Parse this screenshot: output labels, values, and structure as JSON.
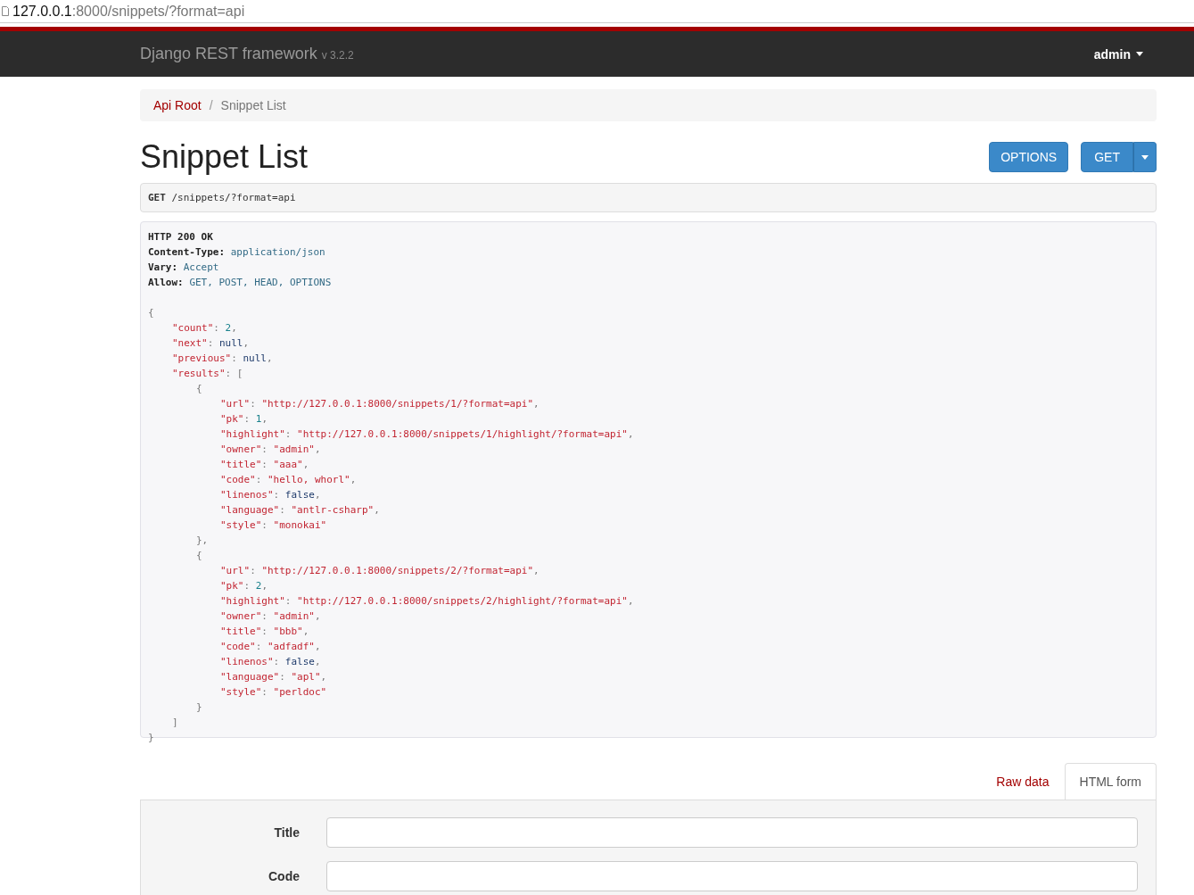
{
  "address_bar": {
    "host": "127.0.0.1",
    "rest": ":8000/snippets/?format=api"
  },
  "navbar": {
    "brand": "Django REST framework",
    "version": "v 3.2.2",
    "user": "admin"
  },
  "breadcrumb": [
    {
      "label": "Api Root",
      "selected": false
    },
    {
      "label": "Snippet List",
      "selected": true
    }
  ],
  "breadcrumb_separator": "/",
  "page_title": "Snippet List",
  "buttons": [
    {
      "label": "OPTIONS",
      "kind": "plain"
    },
    {
      "label": "GET",
      "kind": "split"
    }
  ],
  "request": {
    "method": "GET",
    "path": "/snippets/?format=api"
  },
  "response_headers": [
    {
      "name": "HTTP 200 OK"
    },
    {
      "name": "Content-Type:",
      "value": "application/json"
    },
    {
      "name": "Vary:",
      "value": "Accept"
    },
    {
      "name": "Allow:",
      "value": "GET, POST, HEAD, OPTIONS"
    }
  ],
  "response_body": [
    {
      "tokens": [
        {
          "kind": "punct",
          "text": "{"
        }
      ],
      "children": [
        {
          "tokens": [
            {
              "kind": "key",
              "text": "\"count\""
            },
            {
              "kind": "punct",
              "text": ": "
            },
            {
              "kind": "number",
              "text": "2"
            },
            {
              "kind": "punct",
              "text": ","
            }
          ]
        },
        {
          "tokens": [
            {
              "kind": "key",
              "text": "\"next\""
            },
            {
              "kind": "punct",
              "text": ": "
            },
            {
              "kind": "literal",
              "text": "null"
            },
            {
              "kind": "punct",
              "text": ","
            }
          ]
        },
        {
          "tokens": [
            {
              "kind": "key",
              "text": "\"previous\""
            },
            {
              "kind": "punct",
              "text": ": "
            },
            {
              "kind": "literal",
              "text": "null"
            },
            {
              "kind": "punct",
              "text": ","
            }
          ]
        },
        {
          "tokens": [
            {
              "kind": "key",
              "text": "\"results\""
            },
            {
              "kind": "punct",
              "text": ": ["
            }
          ],
          "children": [
            {
              "tokens": [
                {
                  "kind": "punct",
                  "text": "{"
                }
              ],
              "children": [
                {
                  "tokens": [
                    {
                      "kind": "key",
                      "text": "\"url\""
                    },
                    {
                      "kind": "punct",
                      "text": ": "
                    },
                    {
                      "kind": "string",
                      "text": "\"http://127.0.0.1:8000/snippets/1/?format=api\""
                    },
                    {
                      "kind": "punct",
                      "text": ","
                    }
                  ]
                },
                {
                  "tokens": [
                    {
                      "kind": "key",
                      "text": "\"pk\""
                    },
                    {
                      "kind": "punct",
                      "text": ": "
                    },
                    {
                      "kind": "number",
                      "text": "1"
                    },
                    {
                      "kind": "punct",
                      "text": ","
                    }
                  ]
                },
                {
                  "tokens": [
                    {
                      "kind": "key",
                      "text": "\"highlight\""
                    },
                    {
                      "kind": "punct",
                      "text": ": "
                    },
                    {
                      "kind": "string",
                      "text": "\"http://127.0.0.1:8000/snippets/1/highlight/?format=api\""
                    },
                    {
                      "kind": "punct",
                      "text": ","
                    }
                  ]
                },
                {
                  "tokens": [
                    {
                      "kind": "key",
                      "text": "\"owner\""
                    },
                    {
                      "kind": "punct",
                      "text": ": "
                    },
                    {
                      "kind": "string",
                      "text": "\"admin\""
                    },
                    {
                      "kind": "punct",
                      "text": ","
                    }
                  ]
                },
                {
                  "tokens": [
                    {
                      "kind": "key",
                      "text": "\"title\""
                    },
                    {
                      "kind": "punct",
                      "text": ": "
                    },
                    {
                      "kind": "string",
                      "text": "\"aaa\""
                    },
                    {
                      "kind": "punct",
                      "text": ","
                    }
                  ]
                },
                {
                  "tokens": [
                    {
                      "kind": "key",
                      "text": "\"code\""
                    },
                    {
                      "kind": "punct",
                      "text": ": "
                    },
                    {
                      "kind": "string",
                      "text": "\"hello, whorl\""
                    },
                    {
                      "kind": "punct",
                      "text": ","
                    }
                  ]
                },
                {
                  "tokens": [
                    {
                      "kind": "key",
                      "text": "\"linenos\""
                    },
                    {
                      "kind": "punct",
                      "text": ": "
                    },
                    {
                      "kind": "literal",
                      "text": "false"
                    },
                    {
                      "kind": "punct",
                      "text": ","
                    }
                  ]
                },
                {
                  "tokens": [
                    {
                      "kind": "key",
                      "text": "\"language\""
                    },
                    {
                      "kind": "punct",
                      "text": ": "
                    },
                    {
                      "kind": "string",
                      "text": "\"antlr-csharp\""
                    },
                    {
                      "kind": "punct",
                      "text": ","
                    }
                  ]
                },
                {
                  "tokens": [
                    {
                      "kind": "key",
                      "text": "\"style\""
                    },
                    {
                      "kind": "punct",
                      "text": ": "
                    },
                    {
                      "kind": "string",
                      "text": "\"monokai\""
                    }
                  ]
                }
              ]
            },
            {
              "tokens": [
                {
                  "kind": "punct",
                  "text": "},"
                }
              ]
            },
            {
              "tokens": [
                {
                  "kind": "punct",
                  "text": "{"
                }
              ],
              "children": [
                {
                  "tokens": [
                    {
                      "kind": "key",
                      "text": "\"url\""
                    },
                    {
                      "kind": "punct",
                      "text": ": "
                    },
                    {
                      "kind": "string",
                      "text": "\"http://127.0.0.1:8000/snippets/2/?format=api\""
                    },
                    {
                      "kind": "punct",
                      "text": ","
                    }
                  ]
                },
                {
                  "tokens": [
                    {
                      "kind": "key",
                      "text": "\"pk\""
                    },
                    {
                      "kind": "punct",
                      "text": ": "
                    },
                    {
                      "kind": "number",
                      "text": "2"
                    },
                    {
                      "kind": "punct",
                      "text": ","
                    }
                  ]
                },
                {
                  "tokens": [
                    {
                      "kind": "key",
                      "text": "\"highlight\""
                    },
                    {
                      "kind": "punct",
                      "text": ": "
                    },
                    {
                      "kind": "string",
                      "text": "\"http://127.0.0.1:8000/snippets/2/highlight/?format=api\""
                    },
                    {
                      "kind": "punct",
                      "text": ","
                    }
                  ]
                },
                {
                  "tokens": [
                    {
                      "kind": "key",
                      "text": "\"owner\""
                    },
                    {
                      "kind": "punct",
                      "text": ": "
                    },
                    {
                      "kind": "string",
                      "text": "\"admin\""
                    },
                    {
                      "kind": "punct",
                      "text": ","
                    }
                  ]
                },
                {
                  "tokens": [
                    {
                      "kind": "key",
                      "text": "\"title\""
                    },
                    {
                      "kind": "punct",
                      "text": ": "
                    },
                    {
                      "kind": "string",
                      "text": "\"bbb\""
                    },
                    {
                      "kind": "punct",
                      "text": ","
                    }
                  ]
                },
                {
                  "tokens": [
                    {
                      "kind": "key",
                      "text": "\"code\""
                    },
                    {
                      "kind": "punct",
                      "text": ": "
                    },
                    {
                      "kind": "string",
                      "text": "\"adfadf\""
                    },
                    {
                      "kind": "punct",
                      "text": ","
                    }
                  ]
                },
                {
                  "tokens": [
                    {
                      "kind": "key",
                      "text": "\"linenos\""
                    },
                    {
                      "kind": "punct",
                      "text": ": "
                    },
                    {
                      "kind": "literal",
                      "text": "false"
                    },
                    {
                      "kind": "punct",
                      "text": ","
                    }
                  ]
                },
                {
                  "tokens": [
                    {
                      "kind": "key",
                      "text": "\"language\""
                    },
                    {
                      "kind": "punct",
                      "text": ": "
                    },
                    {
                      "kind": "string",
                      "text": "\"apl\""
                    },
                    {
                      "kind": "punct",
                      "text": ","
                    }
                  ]
                },
                {
                  "tokens": [
                    {
                      "kind": "key",
                      "text": "\"style\""
                    },
                    {
                      "kind": "punct",
                      "text": ": "
                    },
                    {
                      "kind": "string",
                      "text": "\"perldoc\""
                    }
                  ]
                }
              ]
            },
            {
              "tokens": [
                {
                  "kind": "punct",
                  "text": "}"
                }
              ]
            }
          ]
        },
        {
          "tokens": [
            {
              "kind": "punct",
              "text": "]"
            }
          ]
        }
      ]
    },
    {
      "tokens": [
        {
          "kind": "punct",
          "text": "}"
        }
      ]
    }
  ],
  "form_tabs": [
    {
      "label": "Raw data",
      "selected": false
    },
    {
      "label": "HTML form",
      "selected": true
    }
  ],
  "form_fields": [
    {
      "label": "Title"
    },
    {
      "label": "Code"
    }
  ]
}
